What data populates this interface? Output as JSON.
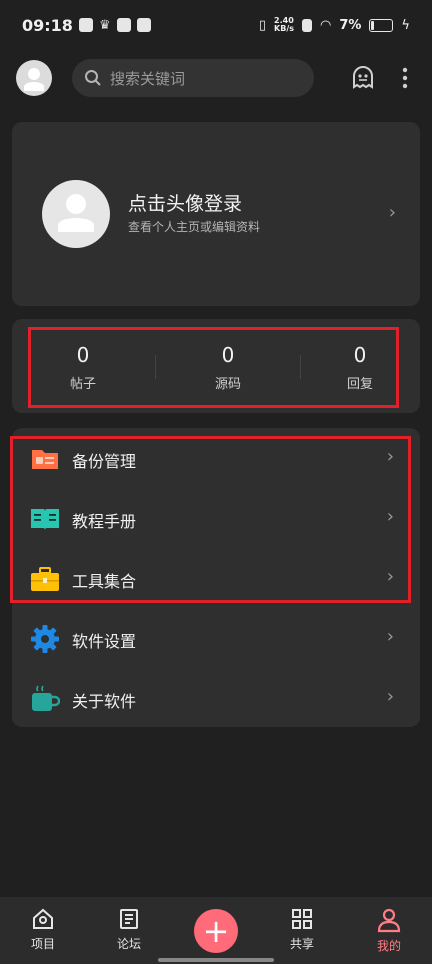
{
  "status": {
    "time": "09:18",
    "speed": "2.40\nKB/s",
    "battery": "7%"
  },
  "search": {
    "placeholder": "搜索关键词"
  },
  "profile": {
    "title": "点击头像登录",
    "subtitle": "查看个人主页或编辑资料"
  },
  "stats": [
    {
      "value": "0",
      "label": "帖子"
    },
    {
      "value": "0",
      "label": "源码"
    },
    {
      "value": "0",
      "label": "回复"
    }
  ],
  "menu": [
    {
      "label": "备份管理",
      "icon": "folder-backup-icon",
      "color": "#ff7043"
    },
    {
      "label": "教程手册",
      "icon": "book-icon",
      "color": "#26c6b0"
    },
    {
      "label": "工具集合",
      "icon": "toolbox-icon",
      "color": "#ffc107"
    },
    {
      "label": "软件设置",
      "icon": "gear-icon",
      "color": "#1e88e5"
    },
    {
      "label": "关于软件",
      "icon": "coffee-cup-icon",
      "color": "#26a69a"
    }
  ],
  "nav": [
    {
      "label": "项目",
      "icon": "home-icon"
    },
    {
      "label": "论坛",
      "icon": "document-icon"
    },
    {
      "label": "",
      "icon": "plus-icon"
    },
    {
      "label": "共享",
      "icon": "grid-icon"
    },
    {
      "label": "我的",
      "icon": "person-icon",
      "active": true
    }
  ],
  "colors": {
    "accent": "#ff6b78",
    "highlight": "#e1202a",
    "card": "#2f2f2f",
    "background": "#202020"
  }
}
